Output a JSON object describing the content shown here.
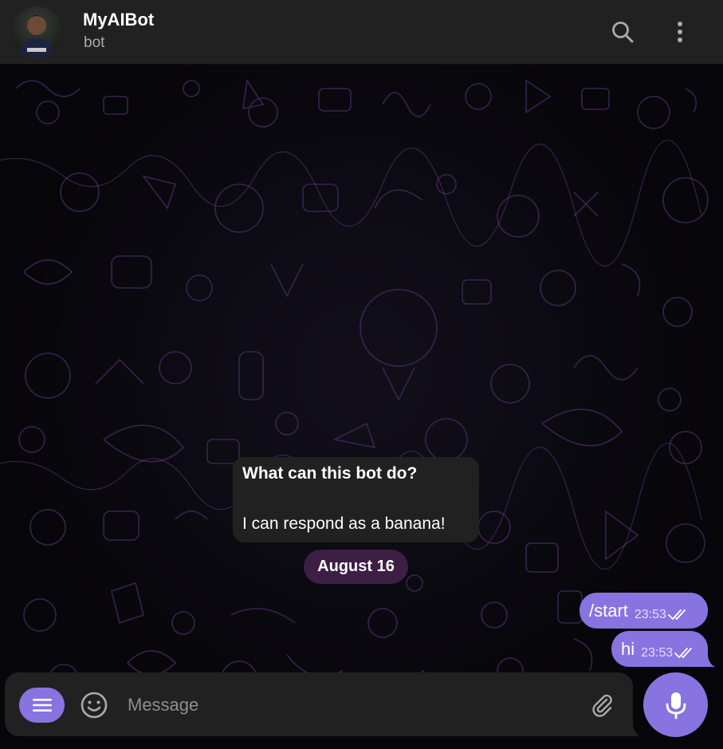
{
  "chat": {
    "title": "MyAIBot",
    "subtitle": "bot"
  },
  "service_message": {
    "question": "What can this bot do?",
    "answer": "I can respond as a banana!"
  },
  "date_label": "August 16",
  "messages": [
    {
      "text": "/start",
      "time": "23:53",
      "status": "read"
    },
    {
      "text": "hi",
      "time": "23:53",
      "status": "read"
    }
  ],
  "composer": {
    "placeholder": "Message"
  },
  "icons": {
    "search": "search-icon",
    "more": "more-vertical-icon",
    "menu": "menu-icon",
    "emoji": "smile-icon",
    "attach": "paperclip-icon",
    "mic": "microphone-icon",
    "read": "double-check-icon"
  },
  "colors": {
    "accent": "#8774e1",
    "header_bg": "#212121",
    "date_pill_bg": "#3d1e45",
    "doodle_purple": "#5a2f75"
  }
}
